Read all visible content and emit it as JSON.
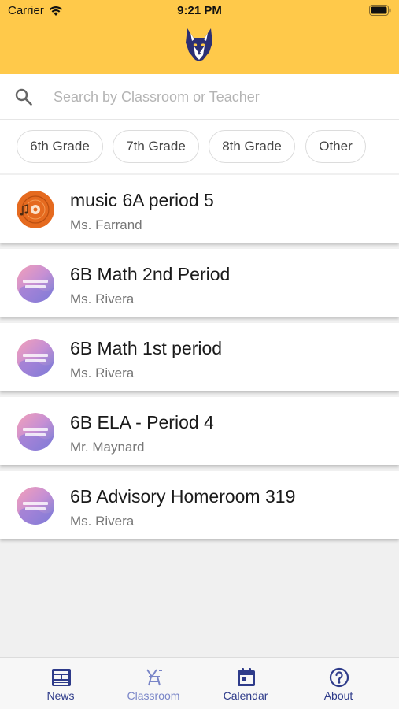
{
  "status_bar": {
    "carrier": "Carrier",
    "time": "9:21 PM"
  },
  "header": {
    "logo": "husky-mascot-logo"
  },
  "search": {
    "placeholder": "Search by Classroom or Teacher",
    "value": ""
  },
  "filters": [
    "6th Grade",
    "7th Grade",
    "8th Grade",
    "Other"
  ],
  "classes": [
    {
      "title": "music 6A period 5",
      "teacher": "Ms. Farrand",
      "avatar": "music-disc"
    },
    {
      "title": "6B Math 2nd Period",
      "teacher": "Ms. Rivera",
      "avatar": "hernandez-hinkles"
    },
    {
      "title": "6B Math 1st period",
      "teacher": "Ms. Rivera",
      "avatar": "hernandez-hinkles"
    },
    {
      "title": "6B ELA - Period 4",
      "teacher": "Mr. Maynard",
      "avatar": "hernandez-hinkles"
    },
    {
      "title": "6B Advisory Homeroom 319",
      "teacher": "Ms. Rivera",
      "avatar": "hernandez-hinkles"
    }
  ],
  "tabs": [
    {
      "label": "News",
      "icon": "newspaper-icon",
      "active": false
    },
    {
      "label": "Classroom",
      "icon": "classroom-icon",
      "active": true
    },
    {
      "label": "Calendar",
      "icon": "calendar-icon",
      "active": false
    },
    {
      "label": "About",
      "icon": "help-icon",
      "active": false
    }
  ],
  "colors": {
    "header": "#ffc94a",
    "tab_active": "#7a86c8",
    "tab_inactive": "#2e3b8a",
    "avatar_music": "#e56a1f"
  }
}
